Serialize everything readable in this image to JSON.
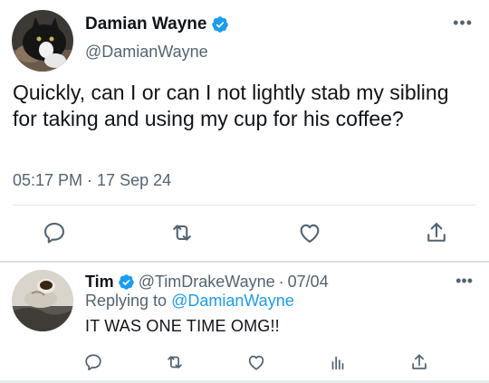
{
  "tweet": {
    "display_name": "Damian Wayne",
    "handle": "@DamianWayne",
    "text": "Quickly, can I or can I not lightly stab my sibling for taking and using my cup for his coffee?",
    "timestamp": "05:17 PM · 17 Sep 24",
    "more": "•••"
  },
  "reply": {
    "display_name": "Tim",
    "handle": "@TimDrakeWayne",
    "separator": "·",
    "date": "07/04",
    "replying_prefix": "Replying to ",
    "replying_mention": "@DamianWayne",
    "text": "IT WAS ONE TIME OMG!!",
    "more": "•••"
  },
  "icons": {
    "verified": "verified-badge-icon",
    "reply": "reply-bubble-icon",
    "retweet": "retweet-icon",
    "like": "heart-icon",
    "share": "share-icon",
    "analytics": "analytics-bars-icon"
  },
  "colors": {
    "accent": "#1d9bf0",
    "secondary_text": "#536471",
    "primary_text": "#0f1419"
  }
}
